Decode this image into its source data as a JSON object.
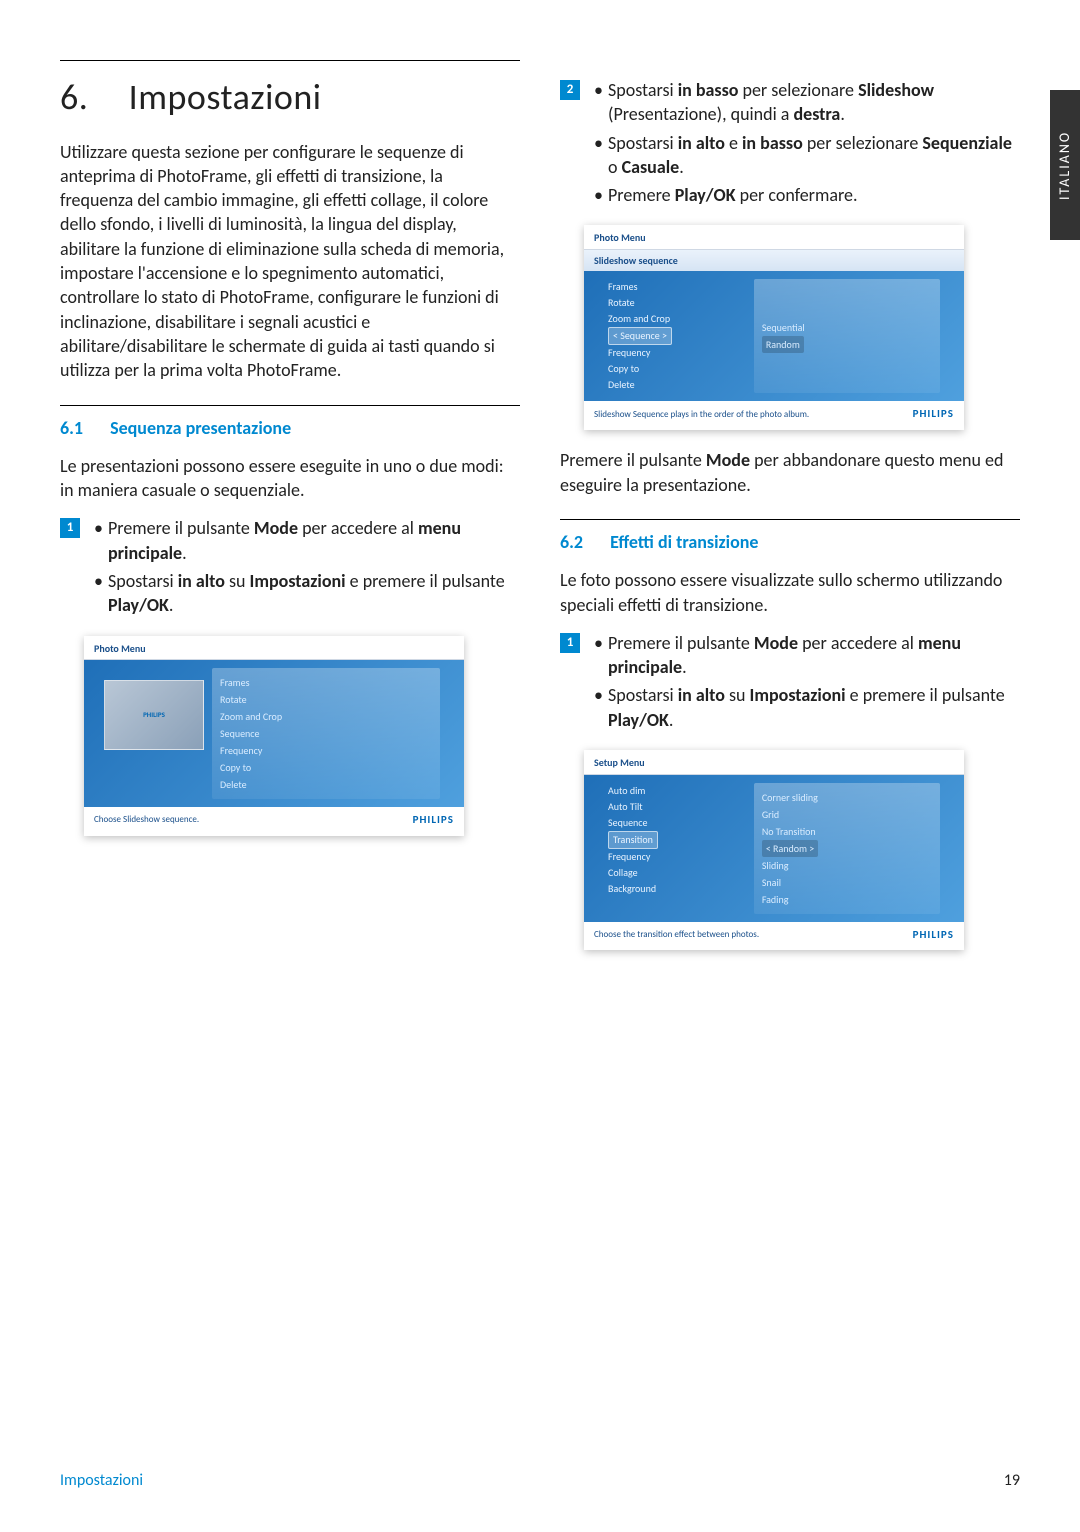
{
  "sideTab": "ITALIANO",
  "chapter": {
    "num": "6.",
    "title": "Impostazioni"
  },
  "intro": "Utilizzare questa sezione per configurare le sequenze di anteprima di PhotoFrame, gli effetti di transizione, la frequenza del cambio immagine, gli effetti collage, il colore dello sfondo, i livelli di luminosità, la lingua del display, abilitare la funzione di eliminazione sulla scheda di memoria, impostare l'accensione e lo spegnimento automatici, controllare lo stato di PhotoFrame, configurare le funzioni di inclinazione, disabilitare i segnali acustici e abilitare/disabilitare le schermate di guida ai tasti quando si utilizza per la prima volta PhotoFrame.",
  "sec61": {
    "num": "6.1",
    "title": "Sequenza presentazione"
  },
  "sec61Body": "Le presentazioni possono essere eseguite in uno o due modi: in maniera casuale o sequenziale.",
  "step1": {
    "a_pre": "Premere il pulsante ",
    "a_b1": "Mode",
    "a_mid": " per accedere al ",
    "a_b2": "menu principale",
    "a_post": ".",
    "b_pre": "Spostarsi ",
    "b_b1": "in alto",
    "b_mid": " su ",
    "b_b2": "Impostazioni",
    "b_mid2": " e premere il pulsante ",
    "b_b3": "Play/OK",
    "b_post": "."
  },
  "step2": {
    "a_pre": "Spostarsi ",
    "a_b1": "in basso",
    "a_mid": " per selezionare ",
    "a_b2": "Slideshow",
    "a_paren": " (Presentazione), quindi a ",
    "a_b3": "destra",
    "a_post": ".",
    "b_pre": "Spostarsi ",
    "b_b1": "in alto",
    "b_mid": " e ",
    "b_b2": "in basso",
    "b_mid2": " per selezionare ",
    "b_b3": "Sequenziale",
    "b_or": " o ",
    "b_b4": "Casuale",
    "b_post": ".",
    "c_pre": "Premere ",
    "c_b1": "Play/OK",
    "c_post": " per confermare."
  },
  "modeNote_pre": "Premere il pulsante ",
  "modeNote_b": "Mode",
  "modeNote_post": " per abbandonare questo menu ed eseguire la presentazione.",
  "sec62": {
    "num": "6.2",
    "title": "Effetti di transizione"
  },
  "sec62Body": "Le foto possono essere visualizzate sullo schermo utilizzando speciali effetti di transizione.",
  "ss1": {
    "header": "Photo Menu",
    "menu": [
      "Frames",
      "Rotate",
      "Zoom and Crop",
      "Sequence",
      "Frequency",
      "Copy to",
      "Delete"
    ],
    "footer": "Choose Slideshow sequence.",
    "brand": "PHILIPS",
    "thumbBrand": "PHILIPS"
  },
  "ss2": {
    "header": "Photo Menu",
    "sub": "Slideshow sequence",
    "menu": [
      "Frames",
      "Rotate",
      "Zoom and Crop",
      "< Sequence >",
      "Frequency",
      "Copy to",
      "Delete"
    ],
    "panel": [
      "Sequential",
      "Random"
    ],
    "footer": "Slideshow Sequence plays in the order of the photo album.",
    "brand": "PHILIPS"
  },
  "ss3": {
    "header": "Setup Menu",
    "menu": [
      "Auto dim",
      "Auto Tilt",
      "Sequence",
      "Transition",
      "Frequency",
      "Collage",
      "Background"
    ],
    "panel": [
      "Corner sliding",
      "Grid",
      "No Transition",
      "< Random >",
      "Sliding",
      "Snail",
      "Fading"
    ],
    "footer": "Choose the transition effect between photos.",
    "brand": "PHILIPS"
  },
  "badges": {
    "one": "1",
    "two": "2"
  },
  "footer": {
    "left": "Impostazioni",
    "right": "19"
  }
}
